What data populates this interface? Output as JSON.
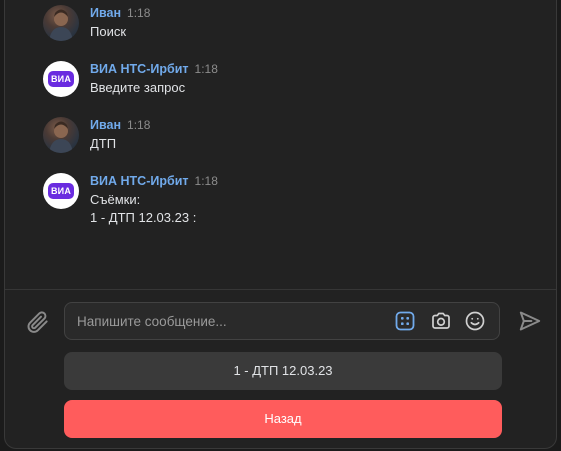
{
  "colors": {
    "author": "#71aaeb",
    "negative_button": "#ff5c5c",
    "secondary_button": "#3a3a3a",
    "bot_logo": "#6a2be0"
  },
  "messages": [
    {
      "author": "Иван",
      "time": "1:18",
      "avatar": "user-avatar",
      "lines": "Поиск"
    },
    {
      "author": "ВИА НТС-Ирбит",
      "time": "1:18",
      "avatar": "bot-avatar",
      "logo_text": "ВИА",
      "lines": "Введите запрос"
    },
    {
      "author": "Иван",
      "time": "1:18",
      "avatar": "user-avatar",
      "lines": "ДТП"
    },
    {
      "author": "ВИА НТС-Ирбит",
      "time": "1:18",
      "avatar": "bot-avatar",
      "logo_text": "ВИА",
      "lines": "Съёмки:\n1 - ДТП 12.03.23 :"
    }
  ],
  "composer": {
    "placeholder": "Напишите сообщение...",
    "icons": [
      "paperclip-icon",
      "keyboard-icon",
      "camera-icon",
      "emoji-icon",
      "send-icon"
    ]
  },
  "keyboard": {
    "buttons": [
      {
        "label": "1 - ДТП 12.03.23",
        "style": "secondary"
      },
      {
        "label": "Назад",
        "style": "negative"
      }
    ]
  }
}
